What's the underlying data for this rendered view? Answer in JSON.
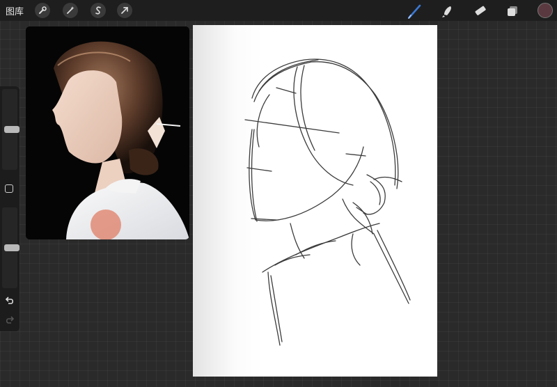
{
  "toolbar": {
    "gallery_label": "图库",
    "left_tools": [
      "wrench-icon",
      "magic-wand-icon",
      "selection-icon",
      "transform-arrow-icon"
    ],
    "right_tools": [
      "brush-icon",
      "smudge-icon",
      "eraser-icon",
      "layers-icon"
    ],
    "active_brush_color": "#3a78d4",
    "current_color": "#5a3a40"
  },
  "sidebar": {
    "brush_size_level": 0.5,
    "opacity_level": 0.5
  },
  "reference": {
    "image": "reference-portrait"
  }
}
